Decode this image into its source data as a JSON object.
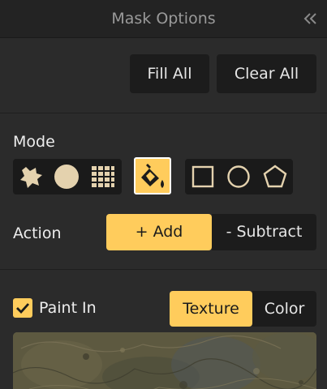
{
  "header": {
    "title": "Mask Options",
    "collapse_icon": "double-chevron-left-icon"
  },
  "toolbar": {
    "fill_all_label": "Fill All",
    "clear_all_label": "Clear All"
  },
  "mode": {
    "label": "Mode",
    "brush_tools": [
      "splat-brush-icon",
      "round-brush-icon",
      "grid-brush-icon"
    ],
    "fill_tool": "paint-bucket-icon",
    "shape_tools": [
      "square-shape-icon",
      "circle-shape-icon",
      "pentagon-shape-icon"
    ],
    "selected": "paint-bucket-icon"
  },
  "action": {
    "label": "Action",
    "add_label": "+ Add",
    "subtract_label": "- Subtract",
    "selected": "add"
  },
  "paint_in": {
    "label": "Paint In",
    "checked": true,
    "texture_label": "Texture",
    "color_label": "Color",
    "selected": "texture"
  },
  "colors": {
    "accent": "#ffcc5c",
    "panel": "#2b2b2b",
    "header": "#232323",
    "control": "#1c1c1c"
  }
}
